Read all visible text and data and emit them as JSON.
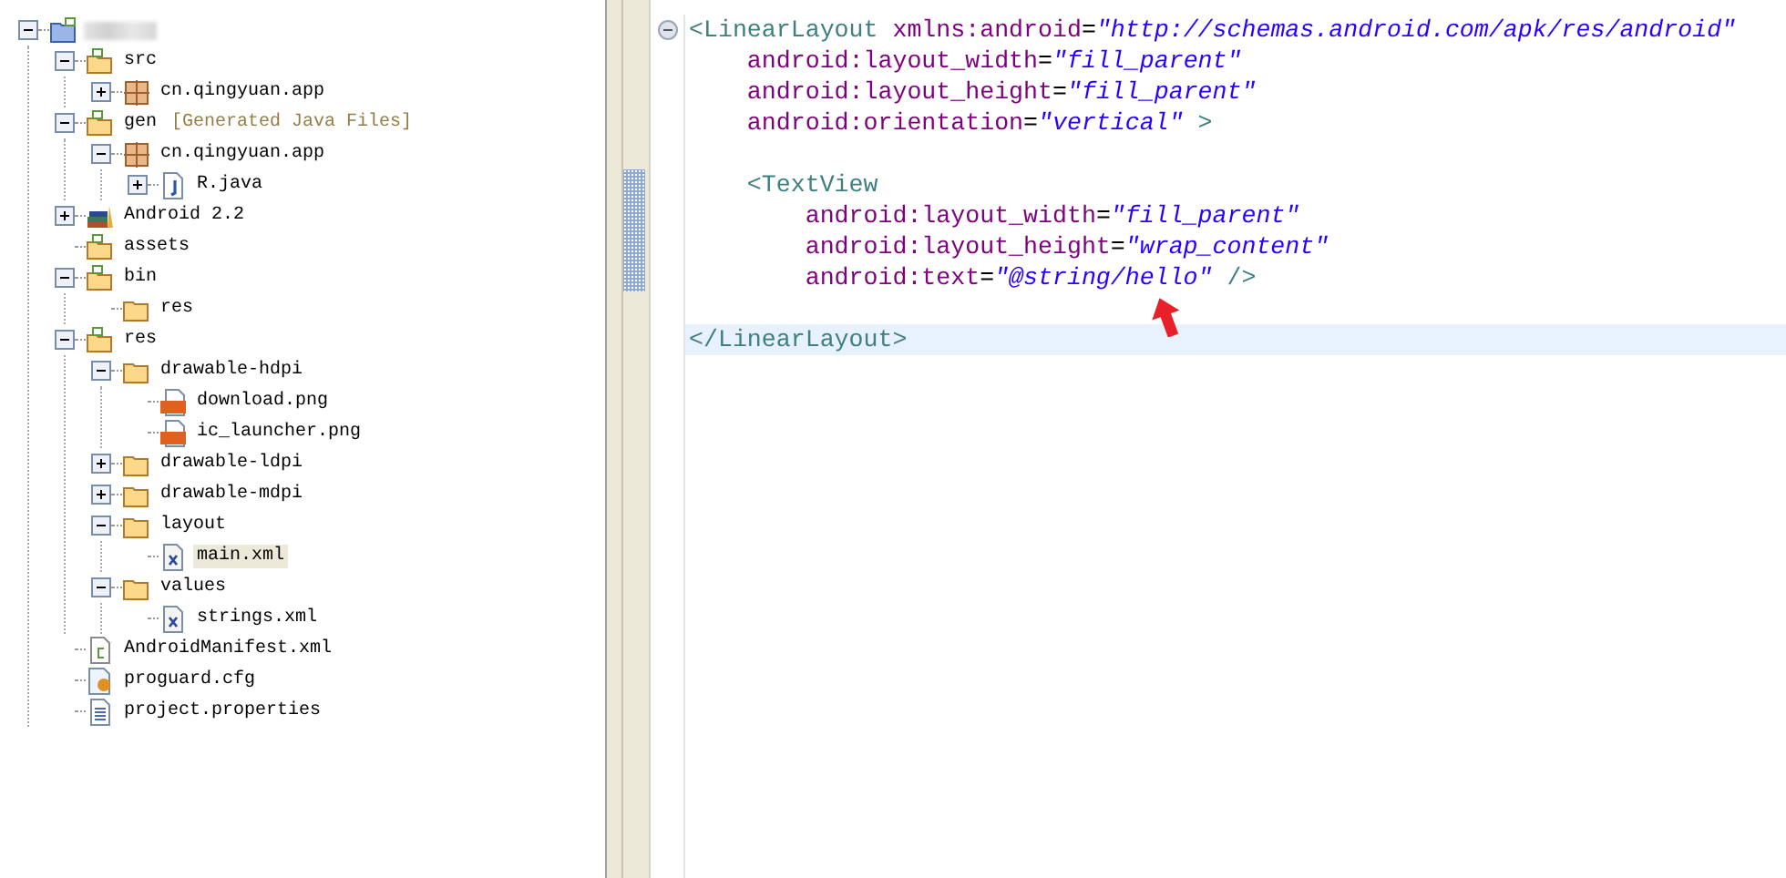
{
  "project_tree": {
    "items": [
      {
        "kind": "project",
        "expanded": true,
        "selected": false,
        "children": [
          {
            "label": "src",
            "kind": "src-folder",
            "expanded": true,
            "selected": false,
            "children": [
              {
                "label": "cn.qingyuan.app",
                "kind": "package",
                "expanded": false,
                "selected": false
              }
            ]
          },
          {
            "label": "gen",
            "decoration": "[Generated Java Files]",
            "kind": "src-folder",
            "expanded": true,
            "selected": false,
            "children": [
              {
                "label": "cn.qingyuan.app",
                "kind": "package",
                "expanded": true,
                "selected": false,
                "children": [
                  {
                    "label": "R.java",
                    "kind": "java",
                    "expanded": false,
                    "selected": false
                  }
                ]
              }
            ]
          },
          {
            "label": "Android 2.2",
            "kind": "library",
            "expanded": false,
            "selected": false
          },
          {
            "label": "assets",
            "kind": "src-folder",
            "selected": false
          },
          {
            "label": "bin",
            "kind": "src-folder",
            "expanded": true,
            "selected": false,
            "children": [
              {
                "label": "res",
                "kind": "folder",
                "selected": false
              }
            ]
          },
          {
            "label": "res",
            "kind": "src-folder",
            "expanded": true,
            "selected": false,
            "children": [
              {
                "label": "drawable-hdpi",
                "kind": "folder",
                "expanded": true,
                "selected": false,
                "children": [
                  {
                    "label": "download.png",
                    "kind": "png",
                    "selected": false
                  },
                  {
                    "label": "ic_launcher.png",
                    "kind": "png",
                    "selected": false
                  }
                ]
              },
              {
                "label": "drawable-ldpi",
                "kind": "folder",
                "expanded": false,
                "selected": false
              },
              {
                "label": "drawable-mdpi",
                "kind": "folder",
                "expanded": false,
                "selected": false
              },
              {
                "label": "layout",
                "kind": "folder",
                "expanded": true,
                "selected": false,
                "children": [
                  {
                    "label": "main.xml",
                    "kind": "xml",
                    "selected": true
                  }
                ]
              },
              {
                "label": "values",
                "kind": "folder",
                "expanded": true,
                "selected": false,
                "children": [
                  {
                    "label": "strings.xml",
                    "kind": "xml",
                    "selected": false
                  }
                ]
              }
            ]
          },
          {
            "label": "AndroidManifest.xml",
            "kind": "manifest",
            "selected": false
          },
          {
            "label": "proguard.cfg",
            "kind": "cfg",
            "selected": false
          },
          {
            "label": "project.properties",
            "kind": "text",
            "selected": false
          }
        ]
      }
    ]
  },
  "editor": {
    "lines": [
      {
        "current": false,
        "foldable": true,
        "tokens": [
          {
            "kind": "tag",
            "text": "<LinearLayout "
          },
          {
            "kind": "attr",
            "text": "xmlns:android"
          },
          {
            "kind": "eq",
            "text": "="
          },
          {
            "kind": "value",
            "text": "\"http://schemas.android.com/apk/res/android\""
          }
        ]
      },
      {
        "current": false,
        "foldable": false,
        "tokens": [
          {
            "kind": "attr",
            "text": "    android:layout_width"
          },
          {
            "kind": "eq",
            "text": "="
          },
          {
            "kind": "value",
            "text": "\"fill_parent\""
          }
        ]
      },
      {
        "current": false,
        "foldable": false,
        "tokens": [
          {
            "kind": "attr",
            "text": "    android:layout_height"
          },
          {
            "kind": "eq",
            "text": "="
          },
          {
            "kind": "value",
            "text": "\"fill_parent\""
          }
        ]
      },
      {
        "current": false,
        "foldable": false,
        "tokens": [
          {
            "kind": "attr",
            "text": "    android:orientation"
          },
          {
            "kind": "eq",
            "text": "="
          },
          {
            "kind": "value",
            "text": "\"vertical\""
          },
          {
            "kind": "tag",
            "text": " >"
          }
        ]
      },
      {
        "current": false
      },
      {
        "current": false,
        "foldable": false,
        "tokens": [
          {
            "kind": "tag",
            "text": "    <TextView"
          }
        ]
      },
      {
        "current": false,
        "foldable": false,
        "tokens": [
          {
            "kind": "attr",
            "text": "        android:layout_width"
          },
          {
            "kind": "eq",
            "text": "="
          },
          {
            "kind": "value",
            "text": "\"fill_parent\""
          }
        ]
      },
      {
        "current": false,
        "foldable": false,
        "tokens": [
          {
            "kind": "attr",
            "text": "        android:layout_height"
          },
          {
            "kind": "eq",
            "text": "="
          },
          {
            "kind": "value",
            "text": "\"wrap_content\""
          }
        ]
      },
      {
        "current": false,
        "foldable": false,
        "tokens": [
          {
            "kind": "attr",
            "text": "        android:text"
          },
          {
            "kind": "eq",
            "text": "="
          },
          {
            "kind": "value",
            "text": "\"@string/hello\""
          },
          {
            "kind": "tag",
            "text": " />"
          }
        ]
      },
      {
        "current": false
      },
      {
        "current": true,
        "foldable": false,
        "tokens": [
          {
            "kind": "tag",
            "text": "</LinearLayout>"
          }
        ]
      }
    ]
  }
}
